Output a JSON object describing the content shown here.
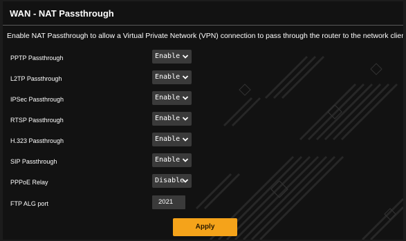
{
  "page": {
    "title": "WAN - NAT Passthrough",
    "description": "Enable NAT Passthrough to allow a Virtual Private Network (VPN) connection to pass through the router to the network clients."
  },
  "rows": [
    {
      "label": "PPTP Passthrough",
      "value": "Enable"
    },
    {
      "label": "L2TP Passthrough",
      "value": "Enable"
    },
    {
      "label": "IPSec Passthrough",
      "value": "Enable"
    },
    {
      "label": "RTSP Passthrough",
      "value": "Enable"
    },
    {
      "label": "H.323 Passthrough",
      "value": "Enable"
    },
    {
      "label": "SIP Passthrough",
      "value": "Enable"
    },
    {
      "label": "PPPoE Relay",
      "value": "Disable"
    }
  ],
  "ftp": {
    "label": "FTP ALG port",
    "value": "2021"
  },
  "apply_label": "Apply",
  "colors": {
    "background": "#121212",
    "control_bg": "#3a3a3a",
    "accent": "#f5a31a",
    "text": "#ffffff"
  },
  "icons": {
    "dropdown": "chevron-down-icon"
  }
}
